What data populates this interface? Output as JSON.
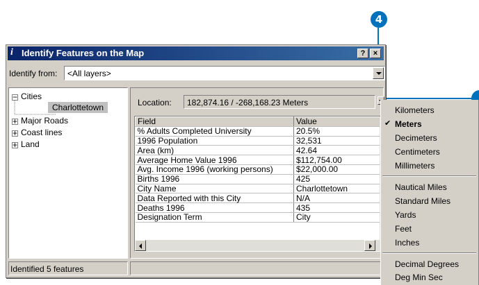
{
  "callouts": {
    "left": "4"
  },
  "window": {
    "title": "Identify Features on the Map",
    "help_label": "?",
    "close_label": "×"
  },
  "identify": {
    "label": "Identify from:",
    "value": "<All layers>"
  },
  "tree": {
    "cities": "Cities",
    "charlottetown": "Charlottetown",
    "major_roads": "Major Roads",
    "coast_lines": "Coast lines",
    "land": "Land"
  },
  "location": {
    "label": "Location:",
    "value": "182,874.16 / -268,168.23 Meters"
  },
  "table": {
    "headers": [
      "Field",
      "Value"
    ],
    "rows": [
      [
        "% Adults Completed University",
        "20.5%"
      ],
      [
        "1996 Population",
        "32,531"
      ],
      [
        "Area (km)",
        "42.64"
      ],
      [
        "Average Home Value 1996",
        "$112,754.00"
      ],
      [
        "Avg. Income 1996 (working persons)",
        "$22,000.00"
      ],
      [
        "Births 1996",
        "425"
      ],
      [
        "City Name",
        "Charlottetown"
      ],
      [
        "Data Reported with this City",
        "N/A"
      ],
      [
        "Deaths 1996",
        "435"
      ],
      [
        "Designation Term",
        "City"
      ]
    ]
  },
  "status": "Identified 5 features",
  "menu": {
    "group1": [
      "Kilometers",
      "Meters",
      "Decimeters",
      "Centimeters",
      "Millimeters"
    ],
    "group2": [
      "Nautical Miles",
      "Standard Miles",
      "Yards",
      "Feet",
      "Inches"
    ],
    "group3": [
      "Decimal Degrees",
      "Deg Min Sec"
    ],
    "selected": "Meters",
    "check": "✔"
  },
  "colors": {
    "callout": "#0072bc",
    "titlebar": "#0a246a",
    "selection": "#c0c0c0"
  }
}
